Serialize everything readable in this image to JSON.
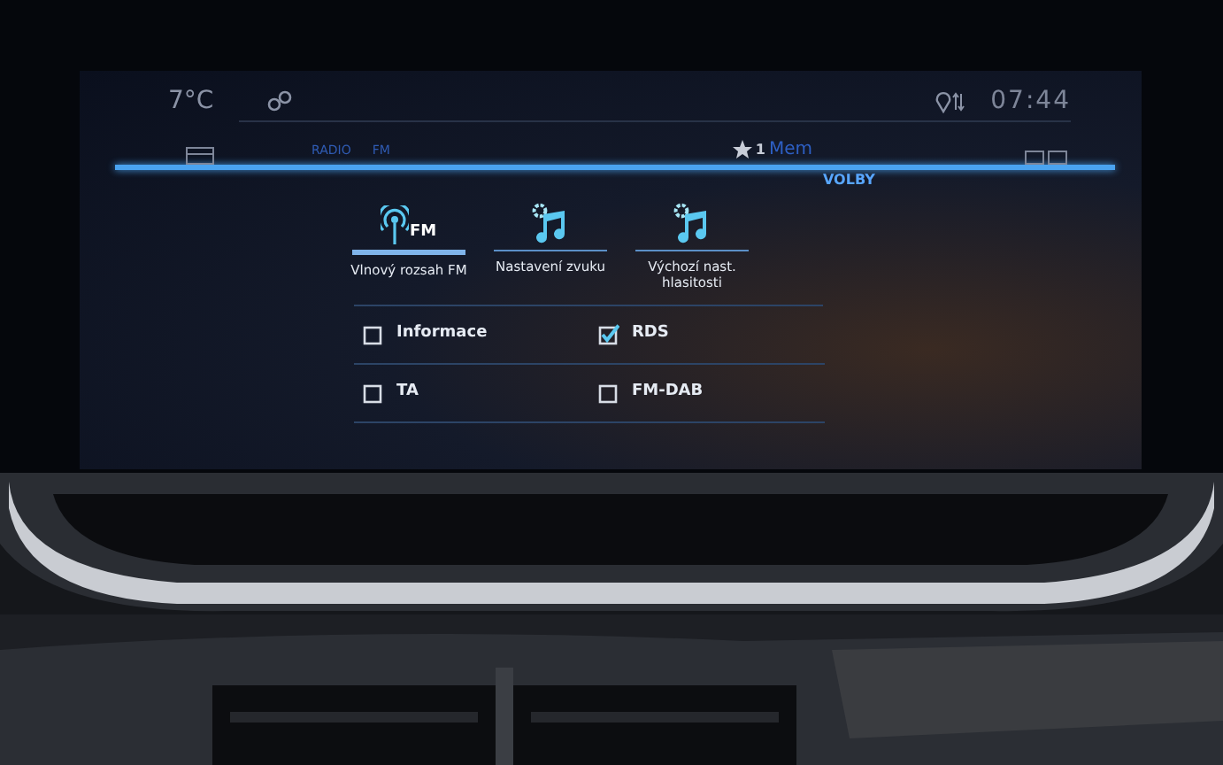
{
  "status": {
    "temperature": "7°C",
    "time": "07:44"
  },
  "header": {
    "source": [
      "RADIO",
      "FM"
    ],
    "memory_number": "1",
    "memory_label": "Mem",
    "selected_tab": "VOLBY"
  },
  "tiles": [
    {
      "label": "Vlnový rozsah FM",
      "icon_text": "FM",
      "kind": "band",
      "selected": true
    },
    {
      "label": "Nastavení zvuku",
      "kind": "sound",
      "selected": false
    },
    {
      "label": "Výchozí nast. hlasitosti",
      "kind": "sound",
      "selected": false
    }
  ],
  "options": [
    {
      "label": "Informace",
      "checked": false
    },
    {
      "label": "RDS",
      "checked": true
    },
    {
      "label": "TA",
      "checked": false
    },
    {
      "label": "FM-DAB",
      "checked": false
    }
  ]
}
